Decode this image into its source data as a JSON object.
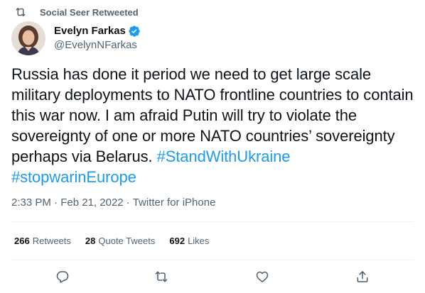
{
  "retweet_banner": {
    "text": "Social Seer Retweeted",
    "icon": "retweet-icon"
  },
  "author": {
    "display_name": "Evelyn Farkas",
    "handle": "@EvelynNFarkas",
    "verified_icon": "verified-badge-icon",
    "accent_color": "#1d9bf0"
  },
  "tweet": {
    "text_main": "Russia has done it period we need to get large scale military deployments to NATO frontline countries to contain this war now. I am afraid Putin will try to violate the sovereignty of one or more NATO countries’ sovereignty perhaps via Belarus. ",
    "hashtags": [
      "#StandWithUkraine",
      "#stopwarinEurope"
    ]
  },
  "meta": {
    "time": "2:33 PM",
    "date": "Feb 21, 2022",
    "source": "Twitter for iPhone"
  },
  "stats": {
    "retweets_count": "266",
    "retweets_label": "Retweets",
    "quote_count": "28",
    "quote_label": "Quote Tweets",
    "likes_count": "692",
    "likes_label": "Likes"
  },
  "actions": [
    "reply-icon",
    "retweet-icon",
    "like-icon",
    "share-icon"
  ]
}
